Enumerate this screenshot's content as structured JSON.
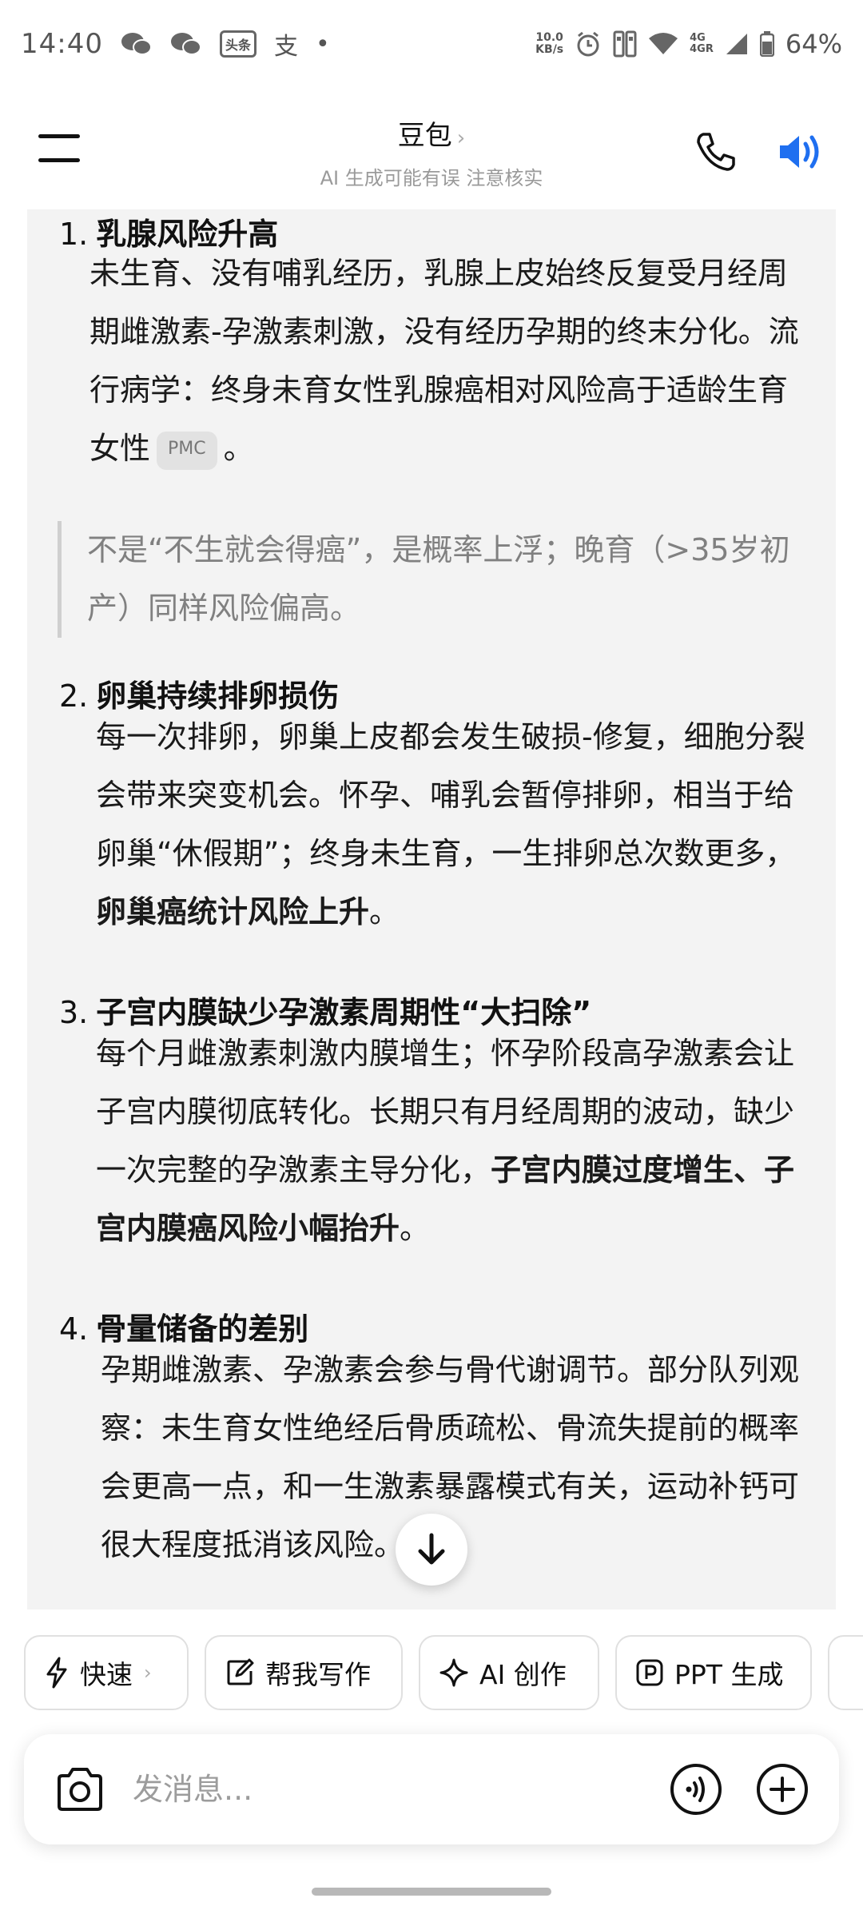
{
  "status_bar": {
    "time": "14:40",
    "app_badge": "头条",
    "app_glyph": "支",
    "dot": "•",
    "net_speed_value": "10.0",
    "net_speed_unit": "KB/s",
    "sig_4g_1": "4G",
    "sig_4g_2": "4GR",
    "battery": "64%"
  },
  "header": {
    "title": "豆包",
    "title_chevron": "›",
    "subtitle": "AI 生成可能有误 注意核实"
  },
  "content": {
    "sections": [
      {
        "num": "1.",
        "title": "乳腺风险升高",
        "body_before_badge": "未生育、没有哺乳经历，乳腺上皮始终反复受月经周期雌激素-孕激素刺激，没有经历孕期的终末分化。流行病学：终身未育女性乳腺癌相对风险高于适龄生育女性",
        "badge": "PMC",
        "body_after_badge": "。",
        "quote": "不是“不生就会得癌”，是概率上浮；晚育（>35岁初产）同样风险偏高。"
      },
      {
        "num": "2.",
        "title": "卵巢持续排卵损伤",
        "body_plain": "每一次排卵，卵巢上皮都会发生破损-修复，细胞分裂会带来突变机会。怀孕、哺乳会暂停排卵，相当于给卵巢“休假期”；终身未生育，一生排卵总次数更多，",
        "body_bold": "卵巢癌统计风险上升",
        "body_end": "。"
      },
      {
        "num": "3.",
        "title": "子宫内膜缺少孕激素周期性“大扫除”",
        "body_plain": "每个月雌激素刺激内膜增生；怀孕阶段高孕激素会让子宫内膜彻底转化。长期只有月经周期的波动，缺少一次完整的孕激素主导分化，",
        "body_bold": "子宫内膜过度增生、子宫内膜癌风险小幅抬升",
        "body_end": "。"
      },
      {
        "num": "4.",
        "title": "骨量储备的差别",
        "body_plain": "孕期雌激素、孕激素会参与骨代谢调节。部分队列观察：未生育女性绝经后骨质疏松、骨流失提前的概率会更高一点，和一生激素暴露模式有关，运动补钙可很大程度抵消该风险。"
      }
    ]
  },
  "chips": [
    {
      "label": "快速",
      "chevron": "›",
      "icon": "lightning-icon"
    },
    {
      "label": "帮我写作",
      "icon": "edit-icon"
    },
    {
      "label": "AI 创作",
      "icon": "sparkle-icon"
    },
    {
      "label": "PPT 生成",
      "icon": "ppt-icon"
    }
  ],
  "input": {
    "placeholder": "发消息..."
  },
  "colors": {
    "accent_blue": "#1f6ff0",
    "content_bg": "#f3f3f3",
    "quote_text": "#808080"
  }
}
